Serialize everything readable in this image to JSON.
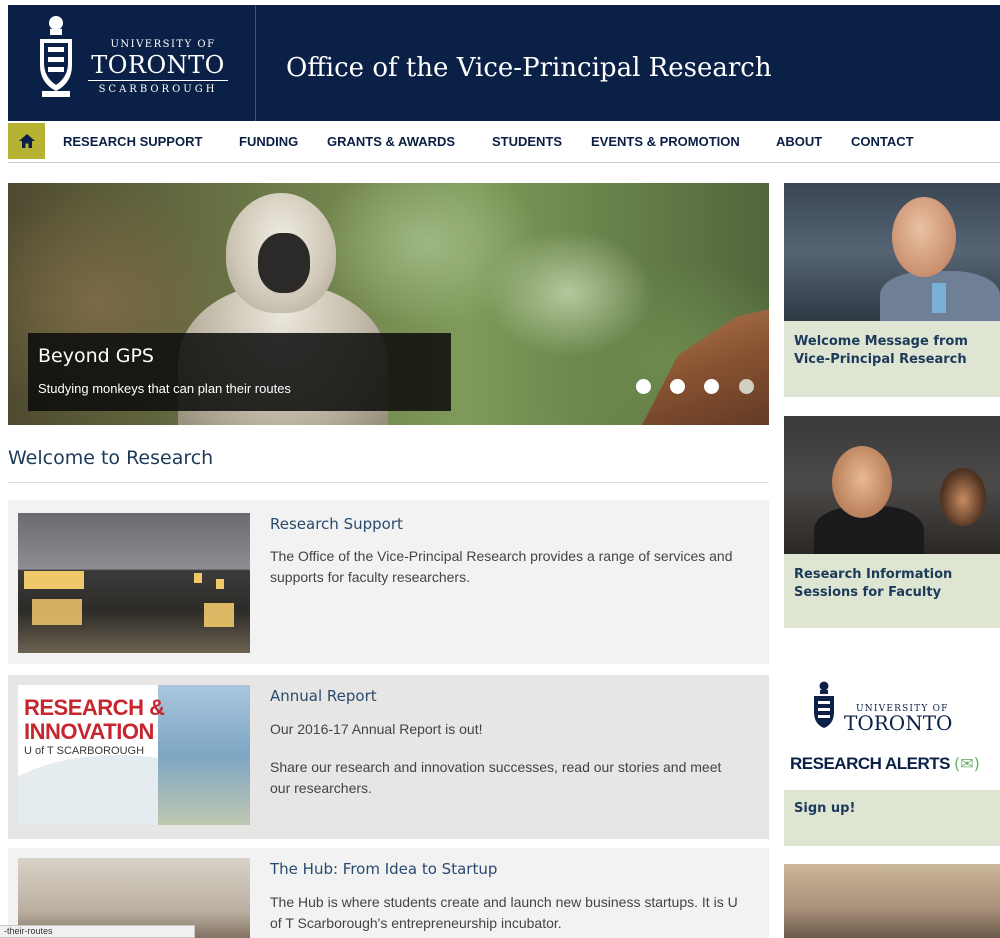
{
  "header": {
    "logo": {
      "line1": "UNIVERSITY OF",
      "line2": "TORONTO",
      "line3": "SCARBOROUGH"
    },
    "site_title": "Office of the Vice-Principal Research"
  },
  "nav": {
    "home_icon": "home-icon",
    "items": [
      "RESEARCH SUPPORT",
      "FUNDING",
      "GRANTS & AWARDS",
      "STUDENTS",
      "EVENTS & PROMOTION",
      "ABOUT",
      "CONTACT"
    ]
  },
  "hero": {
    "title": "Beyond GPS",
    "subtitle": "Studying monkeys that can plan their routes",
    "slide_count": 4,
    "active_slide": 1
  },
  "welcome": {
    "heading": "Welcome to Research",
    "cards": [
      {
        "title": "Research Support",
        "paragraphs": [
          "The Office of the Vice-Principal Research provides a range of services and supports for faculty researchers."
        ]
      },
      {
        "title": "Annual Report",
        "image_text": {
          "line1": "RESEARCH &",
          "line2": "INNOVATION",
          "line3": "U of T SCARBOROUGH"
        },
        "paragraphs": [
          "Our 2016-17 Annual Report is out!",
          "Share our research and innovation successes, read our stories and meet our researchers."
        ]
      },
      {
        "title": "The Hub: From Idea to Startup",
        "paragraphs": [
          "The Hub is where students create and launch new business startups. It is U of T Scarborough's entrepreneurship incubator."
        ]
      }
    ]
  },
  "sidebar": {
    "cards": [
      {
        "label": "Welcome Message from Vice-Principal Research"
      },
      {
        "label": "Research Information Sessions for Faculty"
      },
      {
        "image_text": {
          "univ": "UNIVERSITY OF",
          "toronto": "TORONTO",
          "alerts": "RESEARCH ALERTS"
        },
        "label": "Sign up!"
      }
    ]
  },
  "status_bar": {
    "text": "-their-routes"
  },
  "colors": {
    "header_bg": "#0b2047",
    "home_button": "#b8b233",
    "sidebar_card_bg": "#dfe5d3",
    "link_title": "#2a4a6e"
  }
}
